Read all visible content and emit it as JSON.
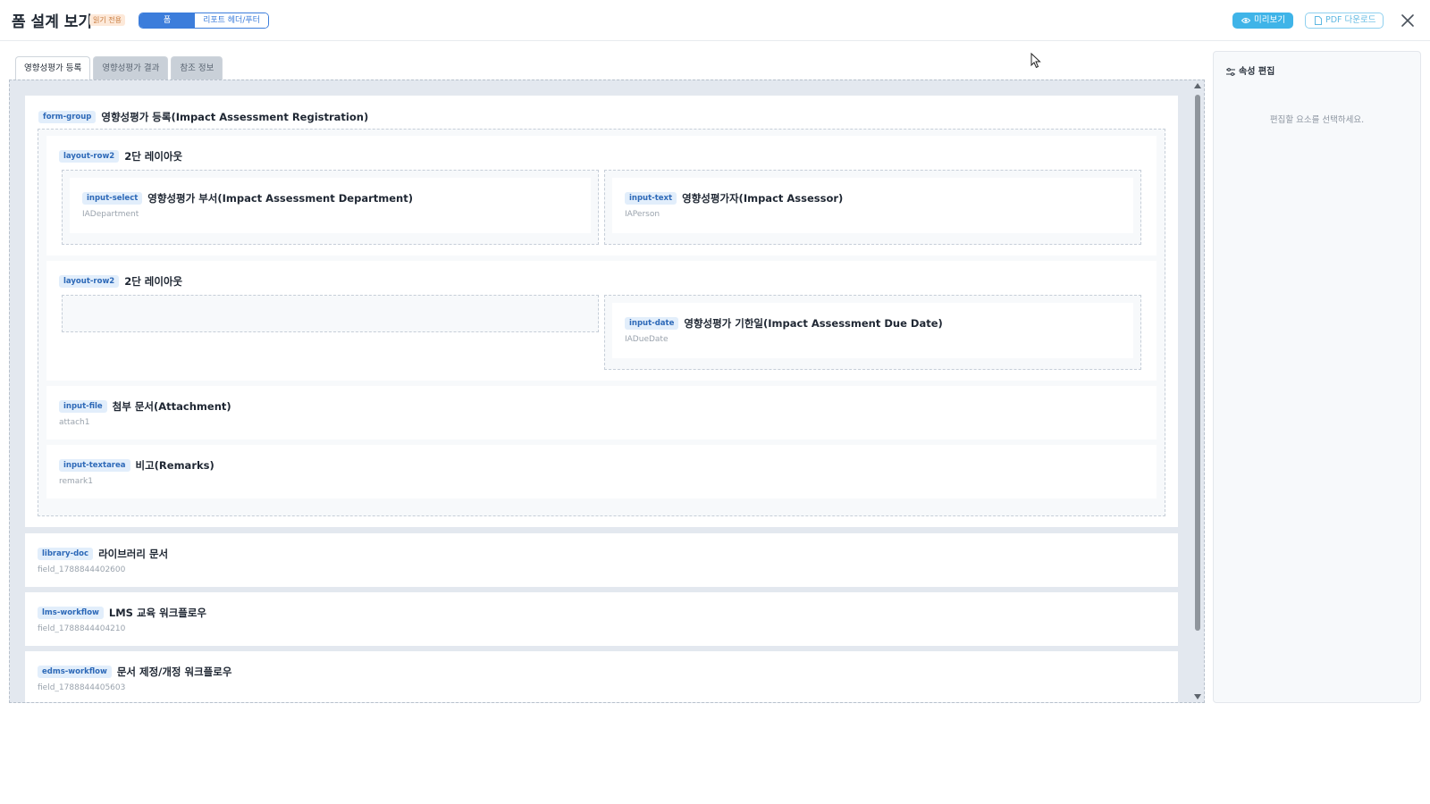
{
  "header": {
    "title": "폼 설계 보기",
    "readonly_badge": "읽기 전용",
    "mode_form": "폼",
    "mode_report": "리포트 헤더/푸터",
    "preview_label": "미리보기",
    "pdf_label": "PDF 다운로드"
  },
  "tabs": [
    {
      "label": "영향성평가 등록",
      "active": true
    },
    {
      "label": "영향성평가 결과",
      "active": false
    },
    {
      "label": "참조 정보",
      "active": false
    }
  ],
  "form_group": {
    "type": "form-group",
    "label": "영향성평가 등록(Impact Assessment Registration)",
    "rows": [
      {
        "type": "layout-row2",
        "label": "2단 레이아웃",
        "left": {
          "type": "input-select",
          "label": "영향성평가 부서(Impact Assessment Department)",
          "field": "IADepartment"
        },
        "right": {
          "type": "input-text",
          "label": "영향성평가자(Impact Assessor)",
          "field": "IAPerson"
        }
      },
      {
        "type": "layout-row2",
        "label": "2단 레이아웃",
        "left": null,
        "right": {
          "type": "input-date",
          "label": "영향성평가 기한일(Impact Assessment Due Date)",
          "field": "IADueDate"
        }
      }
    ],
    "fields": [
      {
        "type": "input-file",
        "label": "첨부 문서(Attachment)",
        "field": "attach1"
      },
      {
        "type": "input-textarea",
        "label": "비고(Remarks)",
        "field": "remark1"
      }
    ]
  },
  "top_items": [
    {
      "type": "library-doc",
      "label": "라이브러리 문서",
      "field": "field_1788844402600"
    },
    {
      "type": "lms-workflow",
      "label": "LMS 교육 워크플로우",
      "field": "field_1788844404210"
    },
    {
      "type": "edms-workflow",
      "label": "문서 제정/개정 워크플로우",
      "field": "field_1788844405603"
    }
  ],
  "properties": {
    "title": "속성 편집",
    "empty_text": "편집할 요소를 선택하세요."
  }
}
